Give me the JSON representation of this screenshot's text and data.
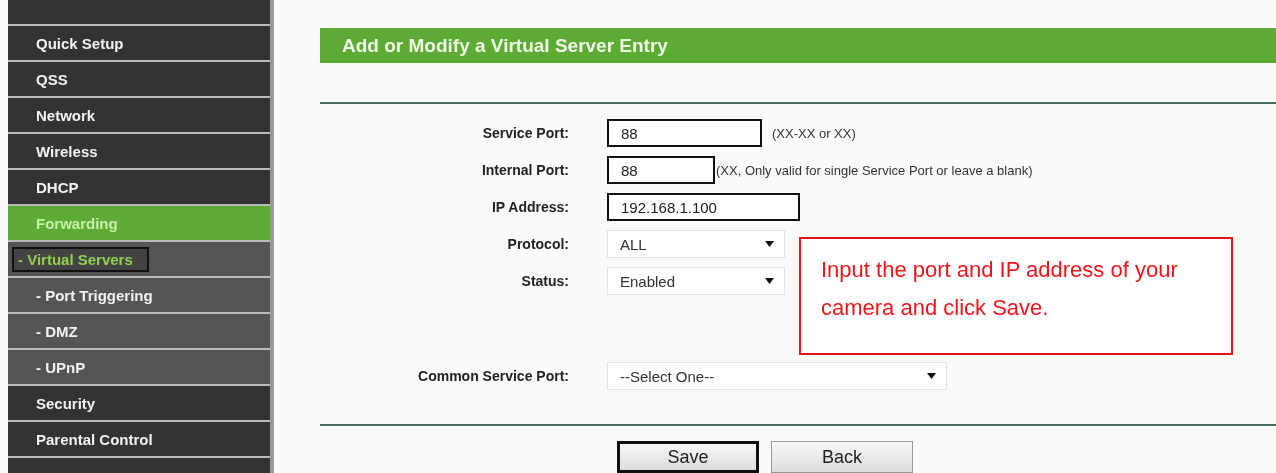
{
  "sidebar": {
    "items": [
      {
        "kind": "partial"
      },
      {
        "label": "Quick Setup",
        "kind": "main",
        "selected": false
      },
      {
        "label": "QSS",
        "kind": "main",
        "selected": false
      },
      {
        "label": "Network",
        "kind": "main",
        "selected": false
      },
      {
        "label": "Wireless",
        "kind": "main",
        "selected": false
      },
      {
        "label": "DHCP",
        "kind": "main",
        "selected": false
      },
      {
        "label": "Forwarding",
        "kind": "main",
        "selected": true
      },
      {
        "label": "- Virtual Servers",
        "kind": "sub",
        "selected": true
      },
      {
        "label": "- Port Triggering",
        "kind": "sub",
        "selected": false
      },
      {
        "label": "- DMZ",
        "kind": "sub",
        "selected": false
      },
      {
        "label": "- UPnP",
        "kind": "sub",
        "selected": false
      },
      {
        "label": "Security",
        "kind": "main",
        "selected": false
      },
      {
        "label": "Parental Control",
        "kind": "main",
        "selected": false
      },
      {
        "kind": "partial"
      }
    ]
  },
  "panel": {
    "title": "Add or Modify a Virtual Server Entry",
    "fields": [
      {
        "label": "Service Port:",
        "kind": "text",
        "value": "88",
        "hint": "(XX-XX or XX)",
        "highlighted": true
      },
      {
        "label": "Internal Port:",
        "kind": "text",
        "value": "88",
        "hint": "(XX, Only valid for single Service Port or leave a blank)",
        "highlighted": true
      },
      {
        "label": "IP Address:",
        "kind": "text",
        "value": "192.168.1.100",
        "highlighted": true
      },
      {
        "label": "Protocol:",
        "kind": "select",
        "value": "ALL",
        "highlighted": false
      },
      {
        "label": "Status:",
        "kind": "select",
        "value": "Enabled",
        "highlighted": false
      },
      {
        "label": "Common Service Port:",
        "kind": "wide-select",
        "value": "--Select One--",
        "highlighted": false
      }
    ],
    "callout": "Input the port and IP address of your camera and click Save.",
    "buttons": [
      {
        "label": "Save",
        "highlighted": true
      },
      {
        "label": "Back",
        "highlighted": false
      }
    ]
  }
}
